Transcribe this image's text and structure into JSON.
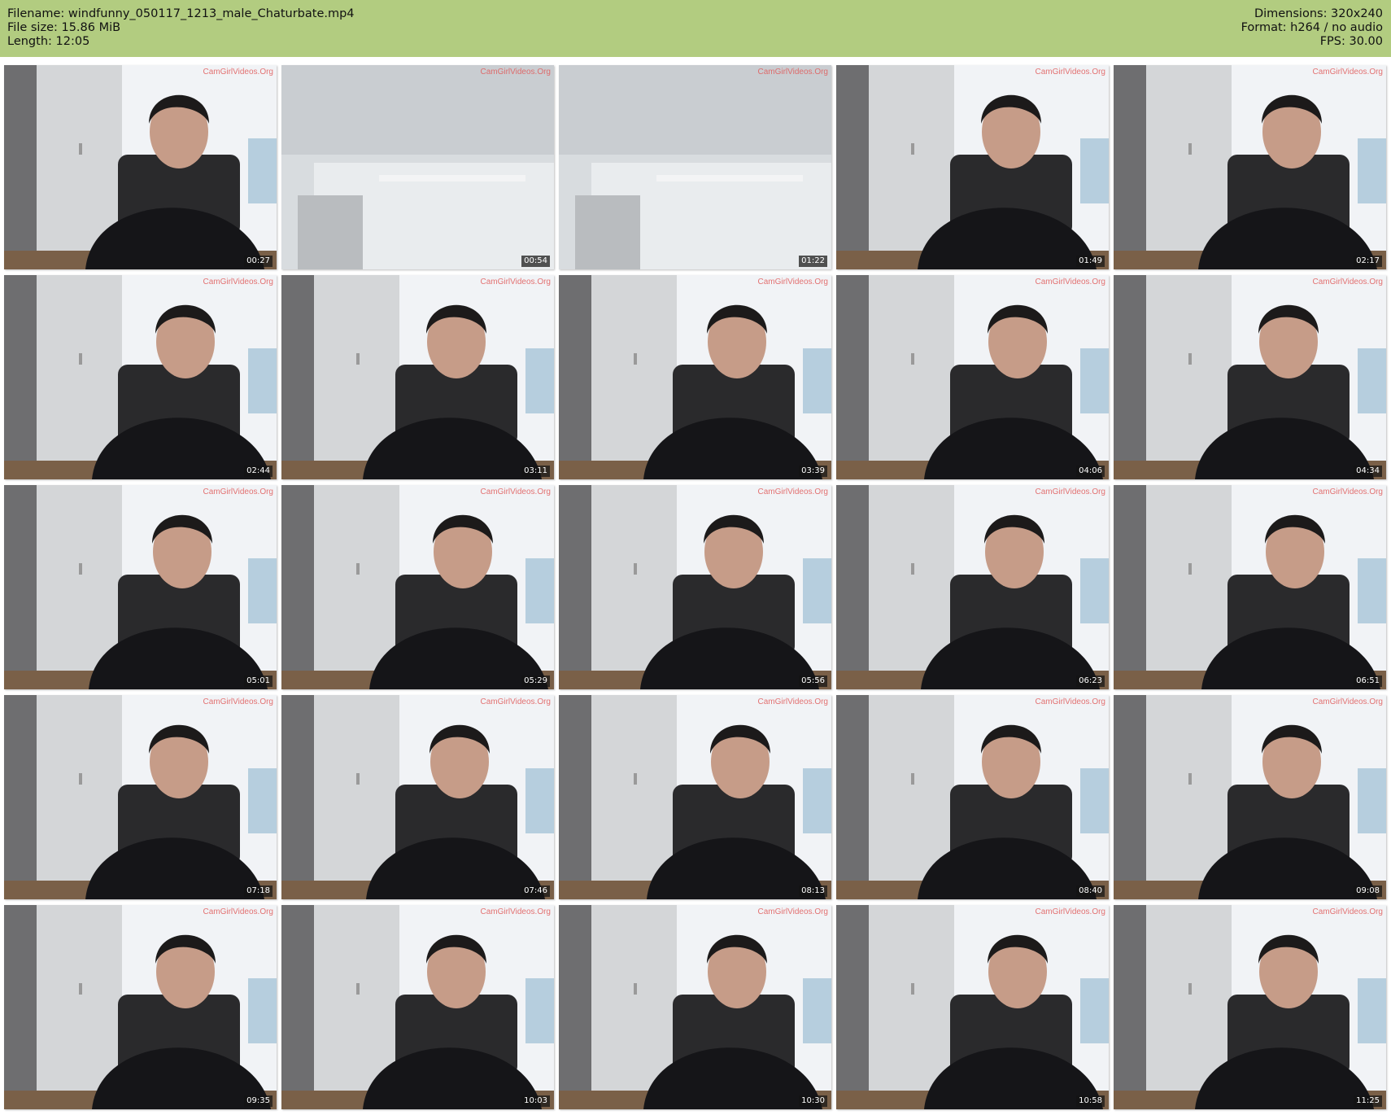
{
  "header": {
    "left": [
      "Filename: windfunny_050117_1213_male_Chaturbate.mp4",
      "File size: 15.86 MiB",
      "Length: 12:05"
    ],
    "right": [
      "Dimensions: 320x240",
      "Format: h264 / no audio",
      "FPS: 30.00"
    ]
  },
  "watermark": "CamGirlVideos.Org",
  "colors": {
    "header_bg": "#b2cc80",
    "timestamp_bg": "#1e1e1e"
  },
  "thumbnails": [
    {
      "time": "00:27",
      "scene": "person"
    },
    {
      "time": "00:54",
      "scene": "ceiling"
    },
    {
      "time": "01:22",
      "scene": "ceiling"
    },
    {
      "time": "01:49",
      "scene": "person"
    },
    {
      "time": "02:17",
      "scene": "person"
    },
    {
      "time": "02:44",
      "scene": "person"
    },
    {
      "time": "03:11",
      "scene": "person"
    },
    {
      "time": "03:39",
      "scene": "person"
    },
    {
      "time": "04:06",
      "scene": "person"
    },
    {
      "time": "04:34",
      "scene": "person"
    },
    {
      "time": "05:01",
      "scene": "person"
    },
    {
      "time": "05:29",
      "scene": "person"
    },
    {
      "time": "05:56",
      "scene": "person"
    },
    {
      "time": "06:23",
      "scene": "person"
    },
    {
      "time": "06:51",
      "scene": "person"
    },
    {
      "time": "07:18",
      "scene": "person"
    },
    {
      "time": "07:46",
      "scene": "person"
    },
    {
      "time": "08:13",
      "scene": "person"
    },
    {
      "time": "08:40",
      "scene": "person"
    },
    {
      "time": "09:08",
      "scene": "person"
    },
    {
      "time": "09:35",
      "scene": "person"
    },
    {
      "time": "10:03",
      "scene": "person"
    },
    {
      "time": "10:30",
      "scene": "person"
    },
    {
      "time": "10:58",
      "scene": "person"
    },
    {
      "time": "11:25",
      "scene": "person"
    }
  ]
}
